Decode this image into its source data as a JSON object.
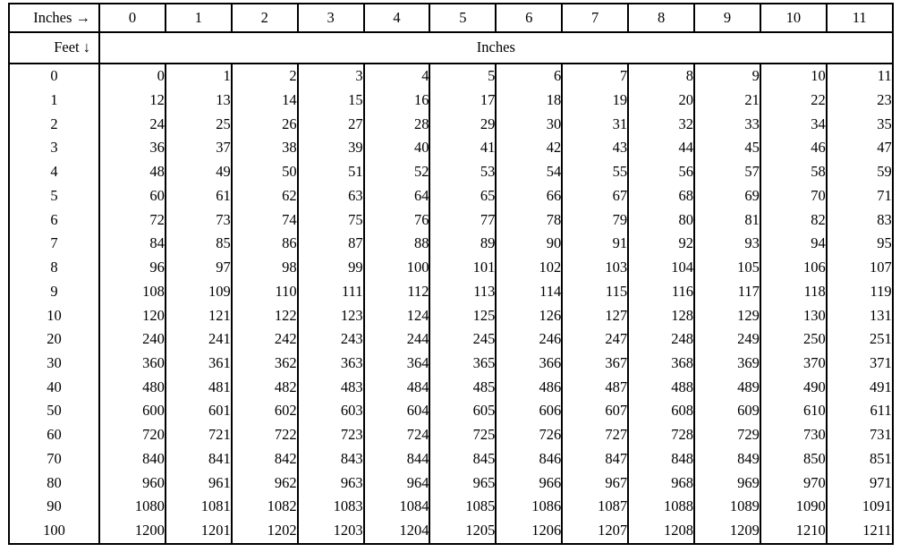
{
  "table": {
    "corner_top_label": "Inches →",
    "corner_left_label": "Feet ↓",
    "span_label": "Inches",
    "column_headers": [
      "0",
      "1",
      "2",
      "3",
      "4",
      "5",
      "6",
      "7",
      "8",
      "9",
      "10",
      "11"
    ],
    "row_headers": [
      "0",
      "1",
      "2",
      "3",
      "4",
      "5",
      "6",
      "7",
      "8",
      "9",
      "10",
      "20",
      "30",
      "40",
      "50",
      "60",
      "70",
      "80",
      "90",
      "100"
    ],
    "rows": [
      [
        "0",
        "1",
        "2",
        "3",
        "4",
        "5",
        "6",
        "7",
        "8",
        "9",
        "10",
        "11"
      ],
      [
        "12",
        "13",
        "14",
        "15",
        "16",
        "17",
        "18",
        "19",
        "20",
        "21",
        "22",
        "23"
      ],
      [
        "24",
        "25",
        "26",
        "27",
        "28",
        "29",
        "30",
        "31",
        "32",
        "33",
        "34",
        "35"
      ],
      [
        "36",
        "37",
        "38",
        "39",
        "40",
        "41",
        "42",
        "43",
        "44",
        "45",
        "46",
        "47"
      ],
      [
        "48",
        "49",
        "50",
        "51",
        "52",
        "53",
        "54",
        "55",
        "56",
        "57",
        "58",
        "59"
      ],
      [
        "60",
        "61",
        "62",
        "63",
        "64",
        "65",
        "66",
        "67",
        "68",
        "69",
        "70",
        "71"
      ],
      [
        "72",
        "73",
        "74",
        "75",
        "76",
        "77",
        "78",
        "79",
        "80",
        "81",
        "82",
        "83"
      ],
      [
        "84",
        "85",
        "86",
        "87",
        "88",
        "89",
        "90",
        "91",
        "92",
        "93",
        "94",
        "95"
      ],
      [
        "96",
        "97",
        "98",
        "99",
        "100",
        "101",
        "102",
        "103",
        "104",
        "105",
        "106",
        "107"
      ],
      [
        "108",
        "109",
        "110",
        "111",
        "112",
        "113",
        "114",
        "115",
        "116",
        "117",
        "118",
        "119"
      ],
      [
        "120",
        "121",
        "122",
        "123",
        "124",
        "125",
        "126",
        "127",
        "128",
        "129",
        "130",
        "131"
      ],
      [
        "240",
        "241",
        "242",
        "243",
        "244",
        "245",
        "246",
        "247",
        "248",
        "249",
        "250",
        "251"
      ],
      [
        "360",
        "361",
        "362",
        "363",
        "364",
        "365",
        "366",
        "367",
        "368",
        "369",
        "370",
        "371"
      ],
      [
        "480",
        "481",
        "482",
        "483",
        "484",
        "485",
        "486",
        "487",
        "488",
        "489",
        "490",
        "491"
      ],
      [
        "600",
        "601",
        "602",
        "603",
        "604",
        "605",
        "606",
        "607",
        "608",
        "609",
        "610",
        "611"
      ],
      [
        "720",
        "721",
        "722",
        "723",
        "724",
        "725",
        "726",
        "727",
        "728",
        "729",
        "730",
        "731"
      ],
      [
        "840",
        "841",
        "842",
        "843",
        "844",
        "845",
        "846",
        "847",
        "848",
        "849",
        "850",
        "851"
      ],
      [
        "960",
        "961",
        "962",
        "963",
        "964",
        "965",
        "966",
        "967",
        "968",
        "969",
        "970",
        "971"
      ],
      [
        "1080",
        "1081",
        "1082",
        "1083",
        "1084",
        "1085",
        "1086",
        "1087",
        "1088",
        "1089",
        "1090",
        "1091"
      ],
      [
        "1200",
        "1201",
        "1202",
        "1203",
        "1204",
        "1205",
        "1206",
        "1207",
        "1208",
        "1209",
        "1210",
        "1211"
      ]
    ]
  },
  "colors": {
    "border": "#000000",
    "text": "#000000",
    "background": "#ffffff"
  }
}
